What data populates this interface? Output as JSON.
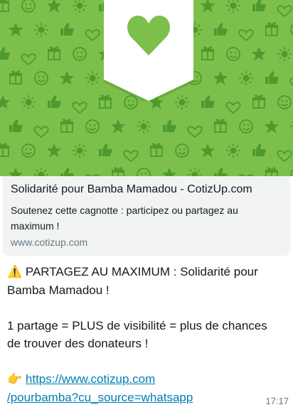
{
  "link_preview": {
    "title": "Solidarité pour Bamba Mamadou - CotizUp.com",
    "description": "Soutenez cette cagnotte : participez ou partagez au maximum !",
    "domain": "www.cotizup.com",
    "image": {
      "background_color": "#7cbf4a",
      "pattern_color": "#4e9a2f",
      "badge_color": "#ffffff",
      "heart_color": "#7cbf4a",
      "icons": [
        "heart-icon",
        "star-icon",
        "sun-icon",
        "smiley-icon",
        "gift-icon",
        "thumbs-up-icon"
      ]
    }
  },
  "message": {
    "line1_emoji": "⚠️",
    "line1": " PARTAGEZ AU MAXIMUM : Solidarité pour",
    "line2": "Bamba Mamadou !",
    "line3": "1 partage = PLUS de visibilité = plus de chances",
    "line4": "de trouver des donateurs !",
    "link_emoji": "👉",
    "link_part1": "https://www.cotizup.com",
    "link_part2": "/pourbamba?cu_source=whatsapp"
  },
  "timestamp": "17:17",
  "colors": {
    "link": "#027eb5",
    "meta_text": "#667781",
    "card_background": "#f2f3f3"
  }
}
